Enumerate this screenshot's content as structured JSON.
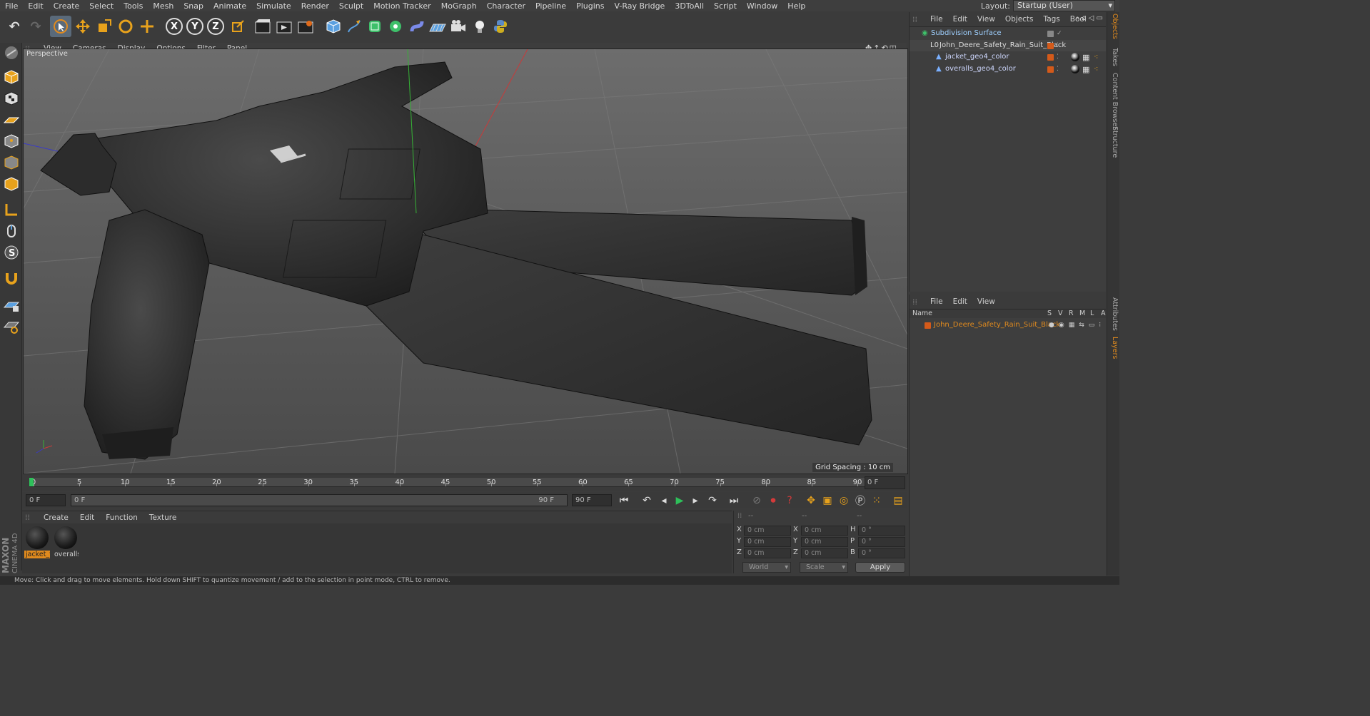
{
  "menu": [
    "File",
    "Edit",
    "Create",
    "Select",
    "Tools",
    "Mesh",
    "Snap",
    "Animate",
    "Simulate",
    "Render",
    "Sculpt",
    "Motion Tracker",
    "MoGraph",
    "Character",
    "Pipeline",
    "Plugins",
    "V-Ray Bridge",
    "3DToAll",
    "Script",
    "Window",
    "Help"
  ],
  "layout": {
    "label": "Layout:",
    "value": "Startup (User)"
  },
  "toolbar": {
    "x_axis": "X",
    "y_axis": "Y",
    "z_axis": "Z"
  },
  "viewport": {
    "menu": [
      "View",
      "Cameras",
      "Display",
      "Options",
      "Filter",
      "Panel"
    ],
    "label": "Perspective",
    "grid_spacing": "Grid Spacing : 10 cm"
  },
  "timeline": {
    "ticks": [
      "0",
      "5",
      "10",
      "15",
      "20",
      "25",
      "30",
      "35",
      "40",
      "45",
      "50",
      "55",
      "60",
      "65",
      "70",
      "75",
      "80",
      "85",
      "90"
    ],
    "current_frame": "0 F"
  },
  "transport": {
    "start": "0 F",
    "range_start": "0 F",
    "range_end": "90 F",
    "end": "90 F"
  },
  "materials": {
    "menu": [
      "Create",
      "Edit",
      "Function",
      "Texture"
    ],
    "items": [
      {
        "label": "jacket_v"
      },
      {
        "label": "overalls"
      }
    ]
  },
  "coords": {
    "headers": [
      "--",
      "--",
      "--"
    ],
    "rows": [
      {
        "a": "X",
        "av": "0 cm",
        "b": "X",
        "bv": "0 cm",
        "c": "H",
        "cv": "0 °"
      },
      {
        "a": "Y",
        "av": "0 cm",
        "b": "Y",
        "bv": "0 cm",
        "c": "P",
        "cv": "0 °"
      },
      {
        "a": "Z",
        "av": "0 cm",
        "b": "Z",
        "bv": "0 cm",
        "c": "B",
        "cv": "0 °"
      }
    ],
    "world": "World",
    "scale": "Scale",
    "apply": "Apply"
  },
  "object_manager": {
    "menu": [
      "File",
      "Edit",
      "View",
      "Objects",
      "Tags",
      "Bool"
    ],
    "objects": [
      {
        "name": "Subdivision Surface"
      },
      {
        "name": "John_Deere_Safety_Rain_Suit_Black"
      },
      {
        "name": "jacket_geo4_color"
      },
      {
        "name": "overalls_geo4_color"
      }
    ]
  },
  "layer_manager": {
    "menu": [
      "File",
      "Edit",
      "View"
    ],
    "columns": {
      "name": "Name",
      "flags": [
        "S",
        "V",
        "R",
        "M",
        "L",
        "A"
      ]
    },
    "layers": [
      {
        "name": "John_Deere_Safety_Rain_Suit_Black"
      }
    ]
  },
  "side_tabs": [
    "Objects",
    "Takes",
    "Content Browser",
    "Structure",
    "Attributes",
    "Layers"
  ],
  "status": "Move: Click and drag to move elements. Hold down SHIFT to quantize movement / add to the selection in point mode, CTRL to remove.",
  "brand": {
    "line1": "MAXON",
    "line2": "CINEMA 4D"
  },
  "colors": {
    "accent": "#e08a1e",
    "layer": "#d45a1a",
    "selected_tool": "#5a6a7a"
  }
}
